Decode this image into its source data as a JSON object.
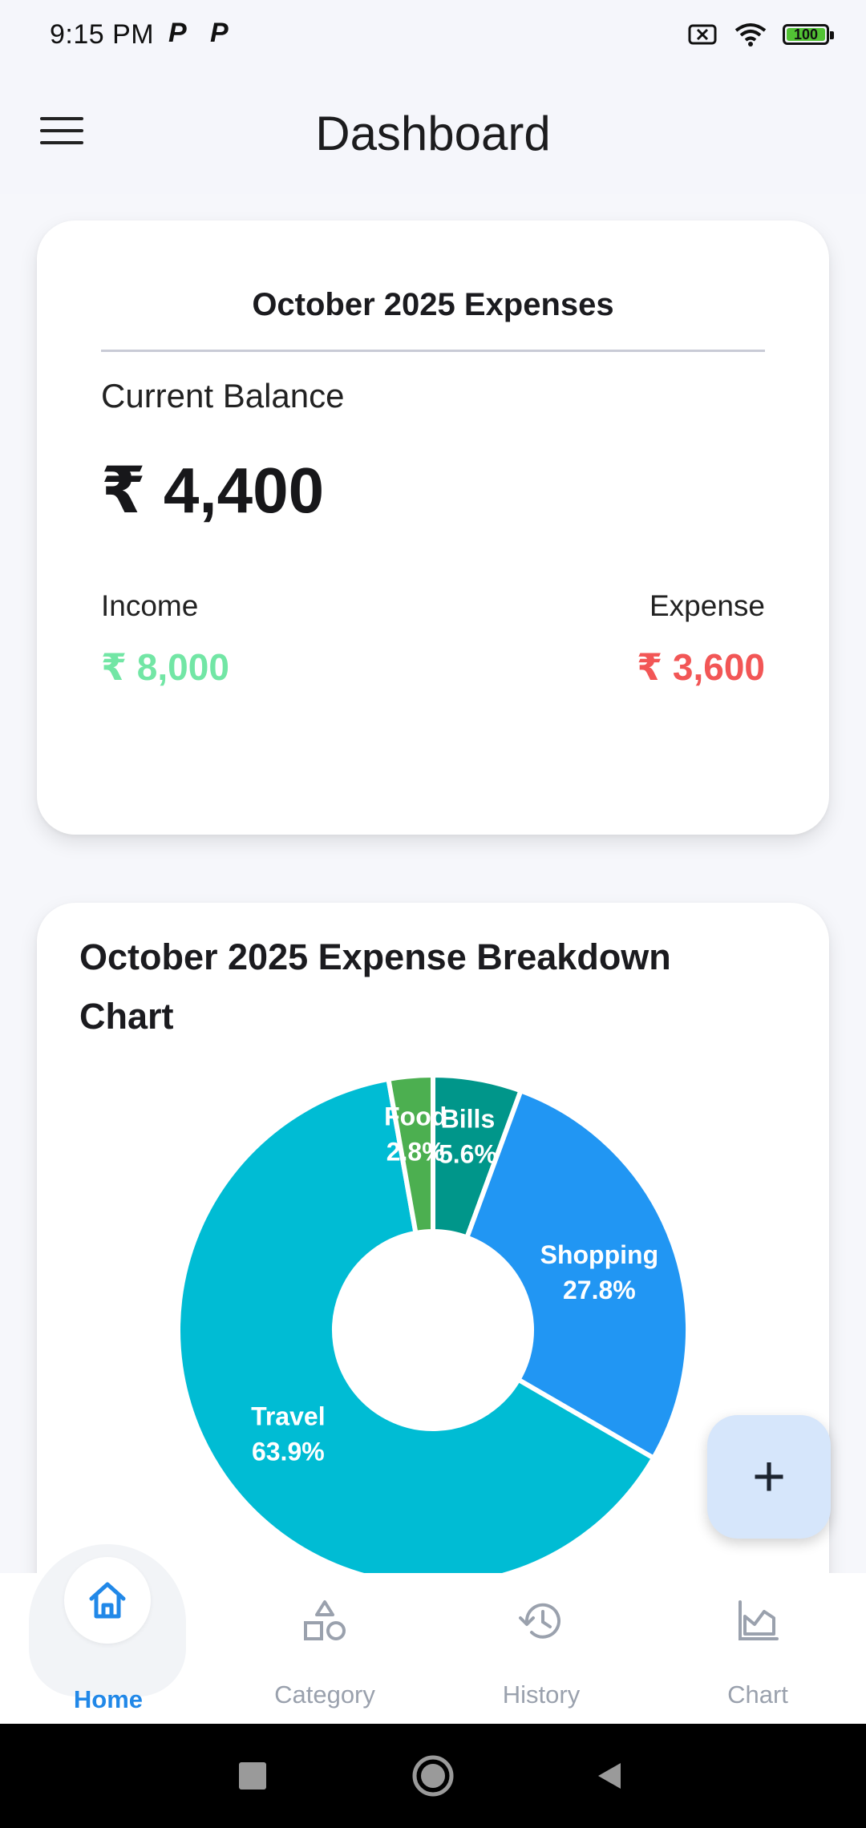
{
  "status_bar": {
    "time": "9:15 PM",
    "notification_icons": [
      "p-app-icon",
      "p-app-icon"
    ],
    "battery_level": "100",
    "battery_fraction": 1.0
  },
  "app_bar": {
    "title": "Dashboard",
    "menu_icon": "hamburger-menu-icon"
  },
  "summary": {
    "title": "October 2025 Expenses",
    "balance_label": "Current Balance",
    "balance_value": "₹ 4,400",
    "income_label": "Income",
    "income_value": "₹ 8,000",
    "expense_label": "Expense",
    "expense_value": "₹ 3,600",
    "income_color": "#72e6a5",
    "expense_color": "#f25656"
  },
  "chart_card": {
    "title": "October 2025 Expense Breakdown Chart"
  },
  "chart_data": {
    "type": "pie",
    "donut": true,
    "categories": [
      "Bills",
      "Shopping",
      "Travel",
      "Food"
    ],
    "values": [
      5.6,
      27.8,
      63.9,
      2.8
    ],
    "labels": [
      "5.6%",
      "27.8%",
      "63.9%",
      "2.8%"
    ],
    "colors": [
      "#00968a",
      "#2196f3",
      "#00bcd4",
      "#4caf50"
    ]
  },
  "fab": {
    "label": "+",
    "icon": "plus-icon"
  },
  "bottom_nav": {
    "items": [
      {
        "label": "Home",
        "icon": "home-icon",
        "active": true
      },
      {
        "label": "Category",
        "icon": "shapes-icon",
        "active": false
      },
      {
        "label": "History",
        "icon": "history-icon",
        "active": false
      },
      {
        "label": "Chart",
        "icon": "area-chart-icon",
        "active": false
      }
    ],
    "active_color": "#2188e8",
    "inactive_color": "#9aa1ad"
  },
  "system_nav": [
    "recents-square-icon",
    "home-circle-icon",
    "back-triangle-icon"
  ]
}
